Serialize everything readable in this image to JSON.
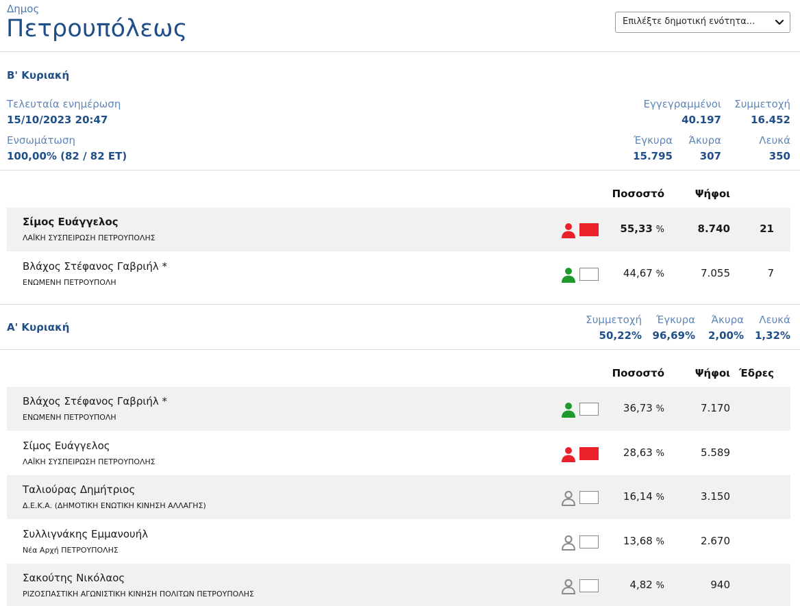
{
  "header": {
    "municipality_label": "Δημος",
    "municipality_name": "Πετρουπόλεως",
    "unit_select": {
      "selected": "Επιλέξτε δημοτική ενότητα..."
    }
  },
  "round_b": {
    "title": "Β' Κυριακή",
    "last_update_label": "Τελευταία ενημέρωση",
    "last_update_value": "15/10/2023 20:47",
    "integration_label": "Ενσωμάτωση",
    "integration_value": "100,00% (82 / 82 ΕΤ)",
    "registered_label": "Εγγεγραμμένοι",
    "registered_value": "40.197",
    "turnout_label": "Συμμετοχή",
    "turnout_value": "16.452",
    "valid_label": "Έγκυρα",
    "valid_value": "15.795",
    "invalid_label": "Άκυρα",
    "invalid_value": "307",
    "blank_label": "Λευκά",
    "blank_value": "350",
    "col_pct": "Ποσοστό",
    "col_votes": "Ψήφοι",
    "candidates": [
      {
        "name": "Σίμος Ευάγγελος",
        "party": "ΛΑΪΚΗ ΣΥΣΠΕΙΡΩΣΗ ΠΕΤΡΟΥΠΟΛΗΣ",
        "pct": "55,33",
        "pct_sym": "%",
        "votes": "8.740",
        "seats": "21",
        "color": "#e8212a",
        "flag_color": "#e8212a",
        "winner": true
      },
      {
        "name": "Βλάχος Στέφανος Γαβριήλ *",
        "party": "ΕΝΩΜΕΝΗ ΠΕΤΡΟΥΠΟΛΗ",
        "pct": "44,67",
        "pct_sym": "%",
        "votes": "7.055",
        "seats": "7",
        "color": "#1e9a2b",
        "flag_color": "#ffffff",
        "winner": false
      }
    ]
  },
  "round_a": {
    "title": "Α' Κυριακή",
    "turnout_label": "Συμμετοχή",
    "turnout_value": "50,22%",
    "valid_label": "Έγκυρα",
    "valid_value": "96,69%",
    "invalid_label": "Άκυρα",
    "invalid_value": "2,00%",
    "blank_label": "Λευκά",
    "blank_value": "1,32%",
    "col_pct": "Ποσοστό",
    "col_votes": "Ψήφοι",
    "col_seats": "Έδρες",
    "candidates": [
      {
        "name": "Βλάχος Στέφανος Γαβριήλ *",
        "party": "ΕΝΩΜΕΝΗ ΠΕΤΡΟΥΠΟΛΗ",
        "pct": "36,73",
        "pct_sym": "%",
        "votes": "7.170",
        "color": "#1e9a2b",
        "flag_color": "#ffffff",
        "icon": "person-filled-icon"
      },
      {
        "name": "Σίμος Ευάγγελος",
        "party": "ΛΑΪΚΗ ΣΥΣΠΕΙΡΩΣΗ ΠΕΤΡΟΥΠΟΛΗΣ",
        "pct": "28,63",
        "pct_sym": "%",
        "votes": "5.589",
        "color": "#e8212a",
        "flag_color": "#e8212a",
        "icon": "person-filled-icon"
      },
      {
        "name": "Ταλιούρας Δημήτριος",
        "party": "Δ.Ε.Κ.Α. (ΔΗΜΟΤΙΚΗ ΕΝΩΤΙΚΗ ΚΙΝΗΣΗ ΑΛΛΑΓΗΣ)",
        "pct": "16,14",
        "pct_sym": "%",
        "votes": "3.150",
        "color": "#888888",
        "flag_color": "#ffffff",
        "icon": "person-outline-icon"
      },
      {
        "name": "Συλλιγνάκης Εμμανουήλ",
        "party": "Νέα Αρχή ΠΕΤΡΟΥΠΟΛΗΣ",
        "pct": "13,68",
        "pct_sym": "%",
        "votes": "2.670",
        "color": "#888888",
        "flag_color": "#ffffff",
        "icon": "person-outline-icon"
      },
      {
        "name": "Σακούτης Νικόλαος",
        "party": "ΡΙΖΟΣΠΑΣΤΙΚΗ ΑΓΩΝΙΣΤΙΚΗ ΚΙΝΗΣΗ ΠΟΛΙΤΩΝ ΠΕΤΡΟΥΠΟΛΗΣ",
        "pct": "4,82",
        "pct_sym": "%",
        "votes": "940",
        "color": "#888888",
        "flag_color": "#ffffff",
        "icon": "person-outline-icon"
      }
    ]
  }
}
